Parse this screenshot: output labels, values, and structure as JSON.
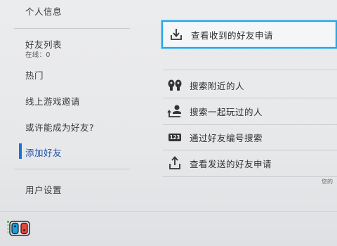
{
  "sidebar": {
    "top_partial": "个人信息",
    "friends_list": "好友列表",
    "online_count": "在线：0",
    "trending": "热门",
    "online_invites": "线上游戏邀请",
    "suggested": "或许能成为好友?",
    "add_friend": "添加好友",
    "user_settings": "用户设置"
  },
  "panel": {
    "received_requests": "查看收到的好友申请",
    "search_nearby": "搜索附近的人",
    "search_played_with": "搜索一起玩过的人",
    "search_by_code_icon_text": "123",
    "search_by_code": "通过好友编号搜索",
    "sent_requests": "查看发送的好友申请",
    "right_partial": "您的"
  },
  "colors": {
    "accent_blue": "#1a73d6",
    "selection_cyan": "#2aa7e6",
    "joycon_blue": "#1a9fe0",
    "joycon_red": "#e8463c",
    "indicator_green": "#3cc24b"
  },
  "icons": [
    "inbox-download-icon",
    "people-nearby-icon",
    "recent-players-icon",
    "number-code-icon",
    "outbox-upload-icon",
    "joycon-controller-icon"
  ]
}
